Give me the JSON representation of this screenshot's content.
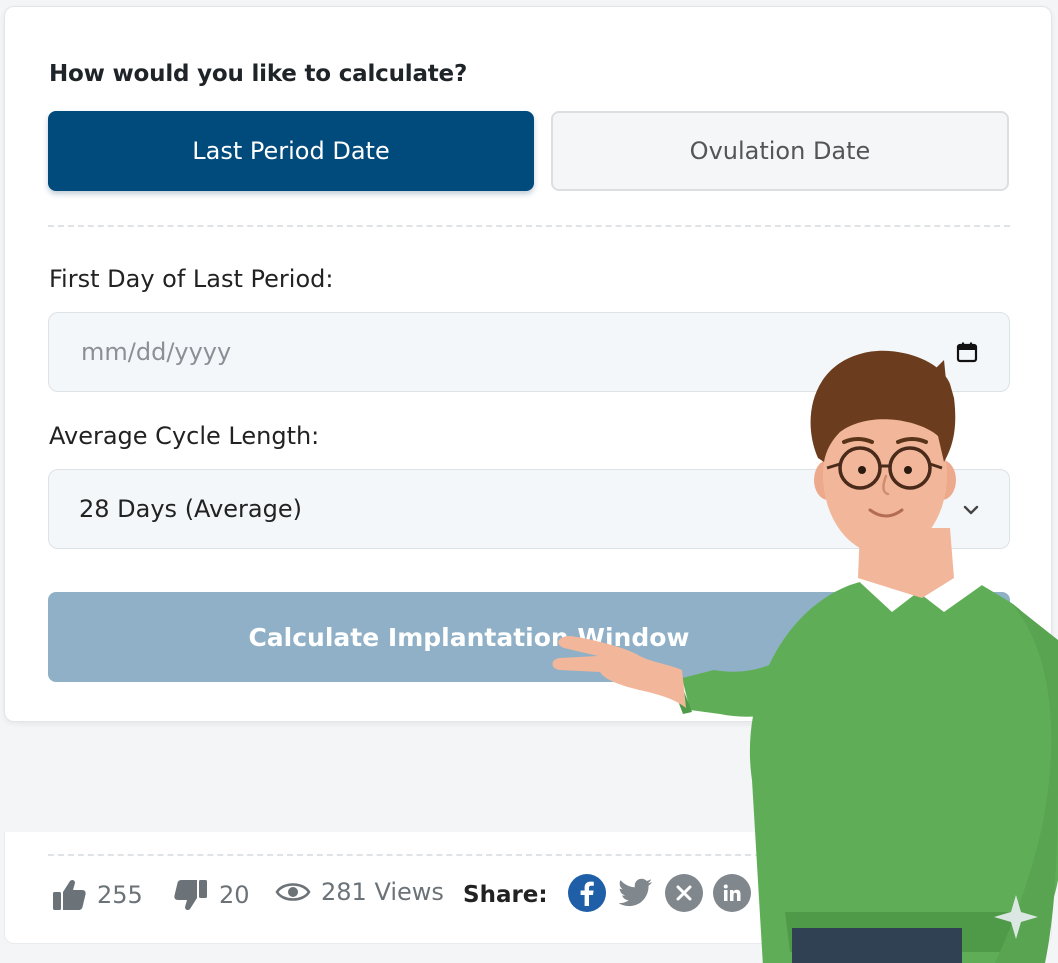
{
  "form": {
    "question": "How would you like to calculate?",
    "options": [
      {
        "label": "Last Period Date",
        "active": true
      },
      {
        "label": "Ovulation Date",
        "active": false
      }
    ],
    "first_day_label": "First Day of Last Period:",
    "date_placeholder": "mm/dd/yyyy",
    "cycle_label": "Average Cycle Length:",
    "cycle_value": "28 Days (Average)",
    "calculate_label": "Calculate Implantation Window"
  },
  "footer": {
    "likes": "255",
    "dislikes": "20",
    "views": "281 Views",
    "share_label": "Share:",
    "social_icons": [
      "facebook-icon",
      "twitter-icon",
      "x-icon",
      "linkedin-icon",
      "whatsapp-icon"
    ]
  },
  "colors": {
    "accent": "#004a7c",
    "button_disabled": "#8fb0c6",
    "facebook": "#1877f2"
  }
}
